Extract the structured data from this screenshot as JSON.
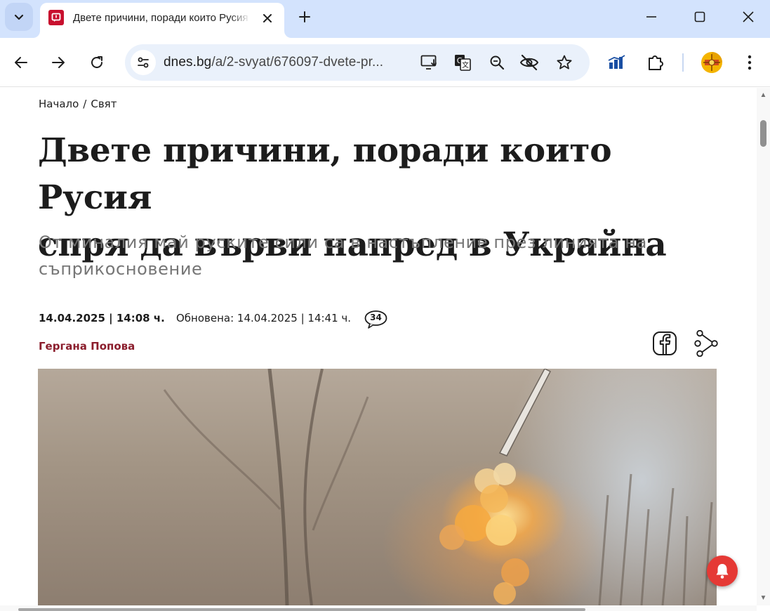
{
  "browser": {
    "tab": {
      "title": "Двете причини, поради които Русия спря да върви напред в Украйна",
      "close_glyph": "✕"
    },
    "new_tab_glyph": "+",
    "address": {
      "host": "dnes.bg",
      "path": "/a/2-svyat/676097-dvete-pr..."
    },
    "icons": {
      "tab_search": "chevron-down-icon",
      "back": "arrow-left-icon",
      "forward": "arrow-right-icon",
      "reload": "reload-icon",
      "site_info": "tune-icon",
      "install": "install-app-icon",
      "translate": "translate-icon",
      "zoom": "zoom-icon",
      "tracking": "eye-off-icon",
      "bookmark": "star-icon",
      "extension_stats": "bar-chart-icon",
      "extensions": "puzzle-icon",
      "profile": "profile-avatar",
      "menu": "kebab-menu-icon"
    }
  },
  "article": {
    "breadcrumb": [
      "Начало",
      "Свят"
    ],
    "breadcrumb_separator": "/",
    "headline_line1": "Двете причини, поради които Русия",
    "headline_line2": "спря да върви напред в Украйна",
    "subhead": "От миналия май руските сили са в настъпление през линията на съприкосновение",
    "published": "14.04.2025 | 14:08 ч.",
    "updated": "Обновена: 14.04.2025 | 14:41 ч.",
    "comments_count": "34",
    "author": "Гергана Попова"
  },
  "colors": {
    "tabstrip": "#d3e3fd",
    "omnibox": "#eaf1fb",
    "author": "#8b1e2d",
    "notification": "#e53935",
    "favicon": "#c8102e"
  }
}
